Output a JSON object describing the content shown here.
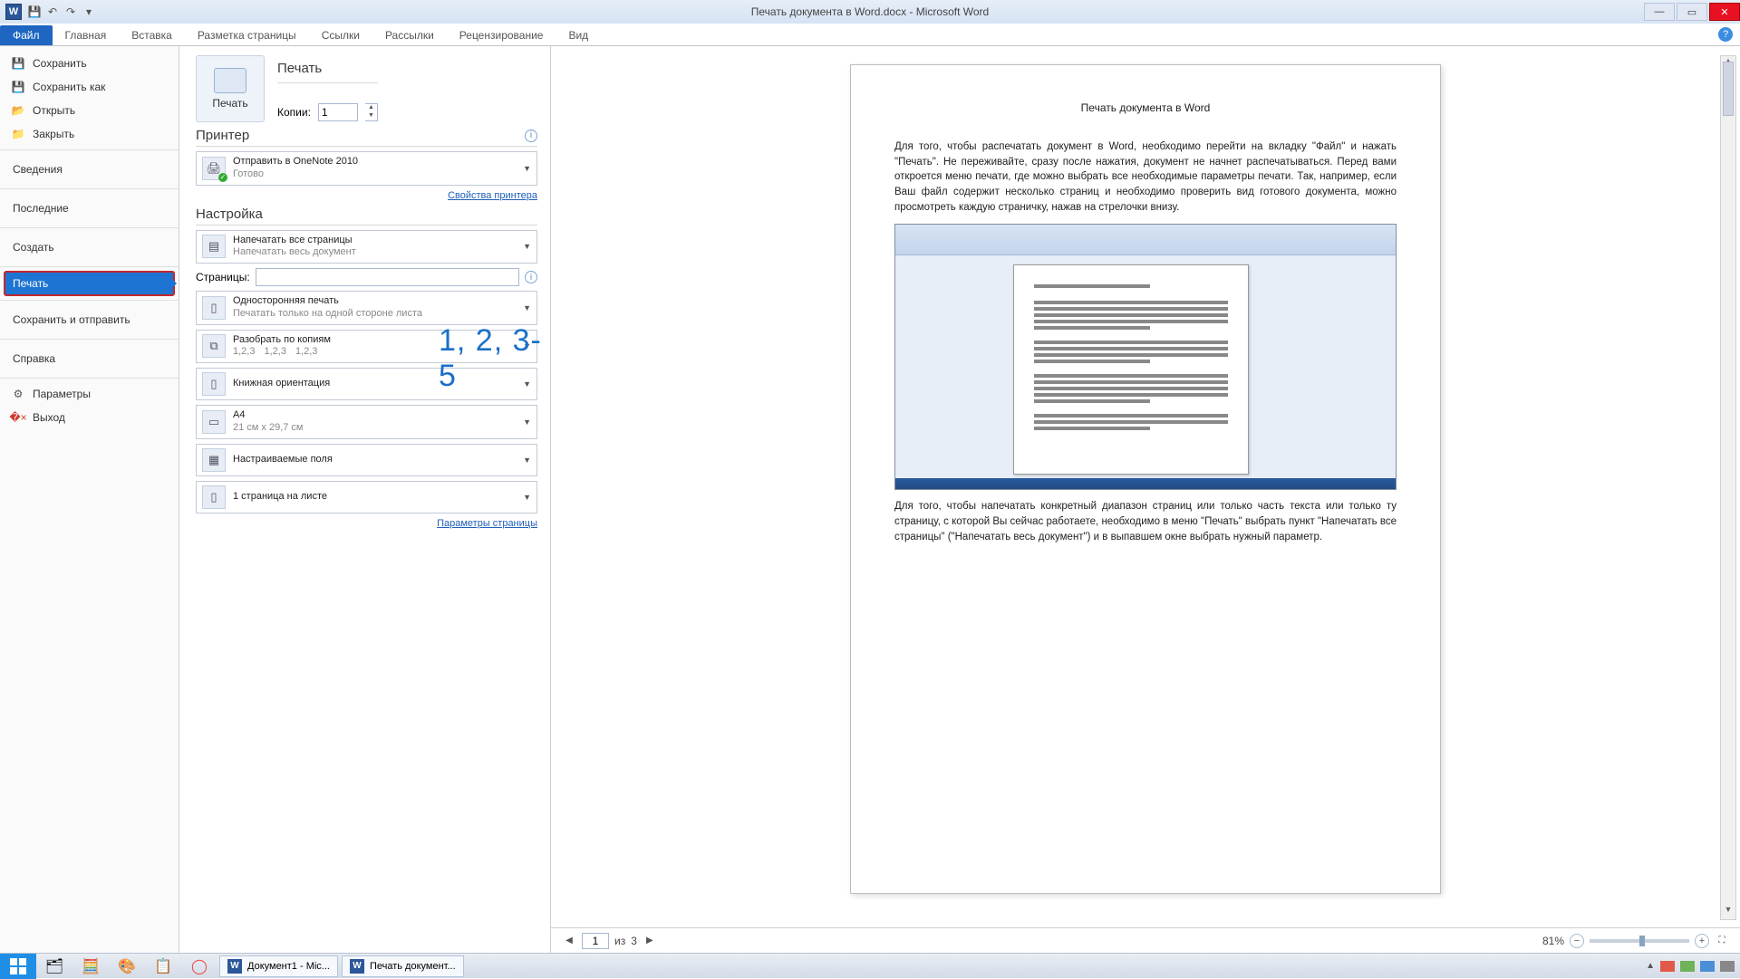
{
  "titlebar": {
    "title": "Печать документа в Word.docx - Microsoft Word"
  },
  "ribbon": {
    "tabs": [
      "Файл",
      "Главная",
      "Вставка",
      "Разметка страницы",
      "Ссылки",
      "Рассылки",
      "Рецензирование",
      "Вид"
    ],
    "active": 0
  },
  "sidebar": {
    "save": "Сохранить",
    "save_as": "Сохранить как",
    "open": "Открыть",
    "close": "Закрыть",
    "info": "Сведения",
    "recent": "Последние",
    "new": "Создать",
    "print": "Печать",
    "send": "Сохранить и отправить",
    "help": "Справка",
    "options": "Параметры",
    "exit": "Выход"
  },
  "settings": {
    "print_heading": "Печать",
    "print_button": "Печать",
    "copies_label": "Копии:",
    "copies_value": "1",
    "printer_heading": "Принтер",
    "printer_name": "Отправить в OneNote 2010",
    "printer_status": "Готово",
    "printer_props": "Свойства принтера",
    "setup_heading": "Настройка",
    "range_t1": "Напечатать все страницы",
    "range_t2": "Напечатать весь документ",
    "pages_label": "Страницы:",
    "pages_value": "",
    "overlay": "1, 2, 3-5",
    "side_t1": "Односторонняя печать",
    "side_t2": "Печатать только на одной стороне листа",
    "collate_t1": "Разобрать по копиям",
    "collate_seq": "1,2,3",
    "orient": "Книжная ориентация",
    "paper_t1": "A4",
    "paper_t2": "21 см x 29,7 см",
    "margins": "Настраиваемые поля",
    "sheets": "1 страница на листе",
    "page_setup": "Параметры страницы"
  },
  "preview": {
    "doc_title": "Печать документа в Word",
    "para1": "Для того, чтобы распечатать документ в Word, необходимо перейти на вкладку \"Файл\" и нажать \"Печать\". Не переживайте, сразу после нажатия, документ не начнет распечатываться. Перед вами откроется меню печати, где можно выбрать все необходимые параметры печати. Так, например, если Ваш файл содержит несколько страниц и необходимо проверить вид готового документа, можно просмотреть каждую страничку, нажав на стрелочки внизу.",
    "para2": "Для того, чтобы напечатать конкретный диапазон страниц или только часть текста или только ту страницу, с которой Вы сейчас работаете, необходимо в меню \"Печать\" выбрать пункт \"Напечатать все страницы\" (\"Напечатать весь документ\") и в выпавшем окне выбрать нужный параметр."
  },
  "nav": {
    "page": "1",
    "of_label": "из",
    "total": "3",
    "zoom": "81%"
  },
  "taskbar": {
    "task1": "Документ1 - Mic...",
    "task2": "Печать документ..."
  }
}
